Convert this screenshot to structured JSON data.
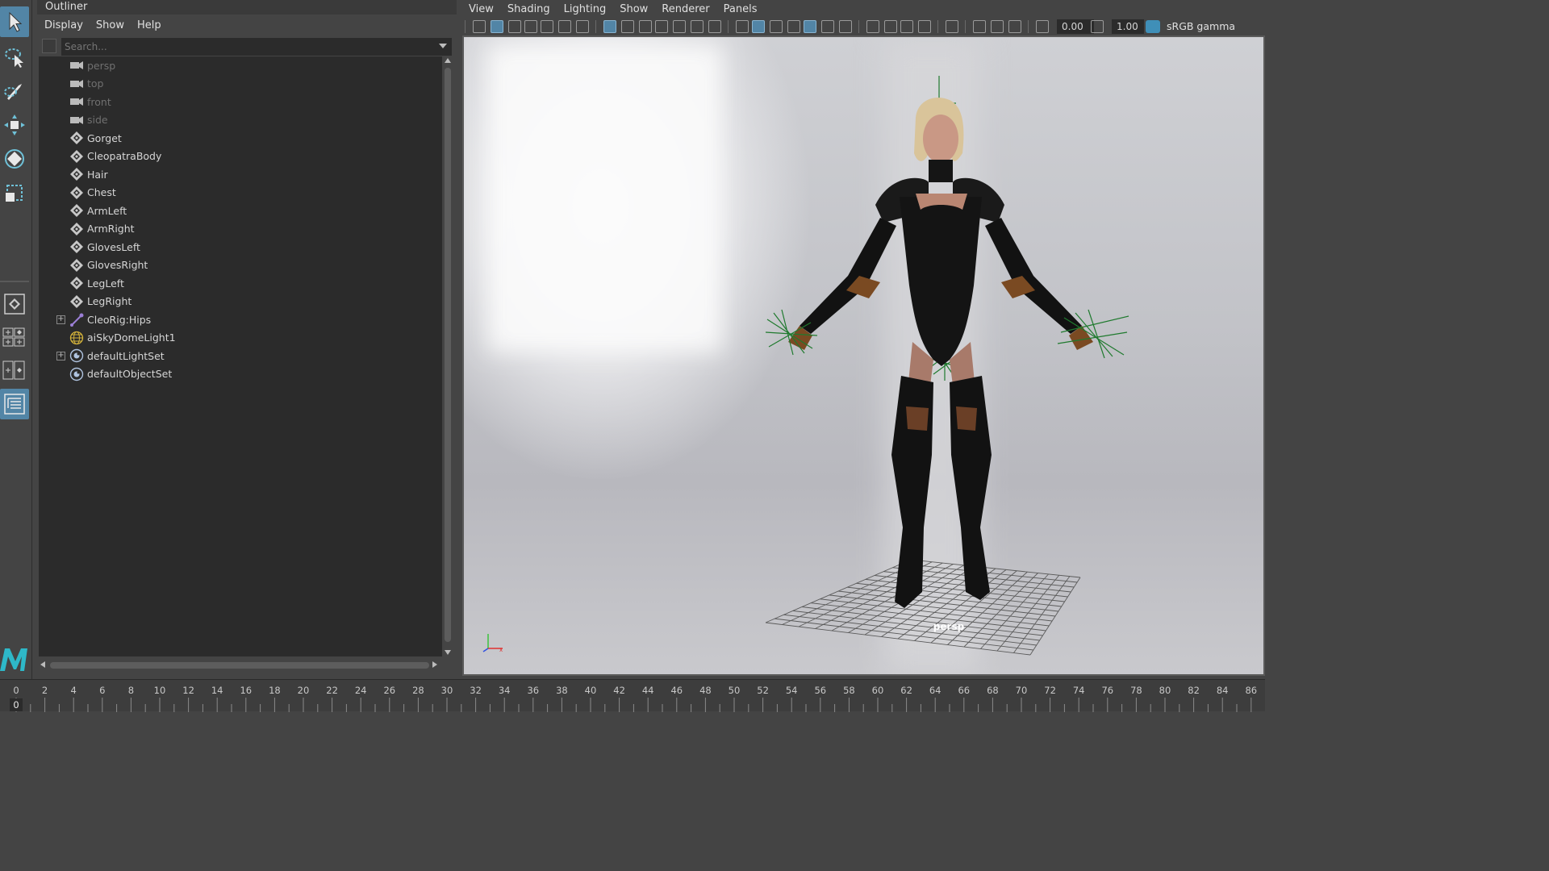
{
  "outliner": {
    "title": "Outliner",
    "menu": [
      "Display",
      "Show",
      "Help"
    ],
    "search_placeholder": "Search...",
    "items": [
      {
        "label": "persp",
        "icon": "camera-icon",
        "dim": true,
        "expandable": false
      },
      {
        "label": "top",
        "icon": "camera-icon",
        "dim": true,
        "expandable": false
      },
      {
        "label": "front",
        "icon": "camera-icon",
        "dim": true,
        "expandable": false
      },
      {
        "label": "side",
        "icon": "camera-icon",
        "dim": true,
        "expandable": false
      },
      {
        "label": "Gorget",
        "icon": "mesh-icon",
        "dim": false,
        "expandable": false
      },
      {
        "label": "CleopatraBody",
        "icon": "mesh-icon",
        "dim": false,
        "expandable": false
      },
      {
        "label": "Hair",
        "icon": "mesh-icon",
        "dim": false,
        "expandable": false
      },
      {
        "label": "Chest",
        "icon": "mesh-icon",
        "dim": false,
        "expandable": false
      },
      {
        "label": "ArmLeft",
        "icon": "mesh-icon",
        "dim": false,
        "expandable": false
      },
      {
        "label": "ArmRight",
        "icon": "mesh-icon",
        "dim": false,
        "expandable": false
      },
      {
        "label": "GlovesLeft",
        "icon": "mesh-icon",
        "dim": false,
        "expandable": false
      },
      {
        "label": "GlovesRight",
        "icon": "mesh-icon",
        "dim": false,
        "expandable": false
      },
      {
        "label": "LegLeft",
        "icon": "mesh-icon",
        "dim": false,
        "expandable": false
      },
      {
        "label": "LegRight",
        "icon": "mesh-icon",
        "dim": false,
        "expandable": false
      },
      {
        "label": "CleoRig:Hips",
        "icon": "joint-icon",
        "dim": false,
        "expandable": true
      },
      {
        "label": "aiSkyDomeLight1",
        "icon": "skydome-icon",
        "dim": false,
        "expandable": false
      },
      {
        "label": "defaultLightSet",
        "icon": "set-icon",
        "dim": false,
        "expandable": true
      },
      {
        "label": "defaultObjectSet",
        "icon": "set-icon",
        "dim": false,
        "expandable": false
      }
    ]
  },
  "viewport": {
    "menu": [
      "View",
      "Shading",
      "Lighting",
      "Show",
      "Renderer",
      "Panels"
    ],
    "exposure_value": "0.00",
    "gamma_value": "1.00",
    "color_space": "sRGB gamma",
    "camera_label": "persp"
  },
  "timeline": {
    "current_frame": "0",
    "tick_labels": [
      "0",
      "2",
      "4",
      "6",
      "8",
      "10",
      "12",
      "14",
      "16",
      "18",
      "20",
      "22",
      "24",
      "26",
      "28",
      "30",
      "32",
      "34",
      "36",
      "38",
      "40",
      "42",
      "44",
      "46",
      "48",
      "50",
      "52",
      "54",
      "56",
      "58",
      "60",
      "62",
      "64",
      "66",
      "68",
      "70",
      "72",
      "74",
      "76",
      "78",
      "80",
      "82",
      "84",
      "86"
    ]
  },
  "colors": {
    "accent": "#5285a6",
    "panel_bg": "#444444",
    "tree_bg": "#2b2b2b",
    "wire_green": "#1f7a2e"
  }
}
